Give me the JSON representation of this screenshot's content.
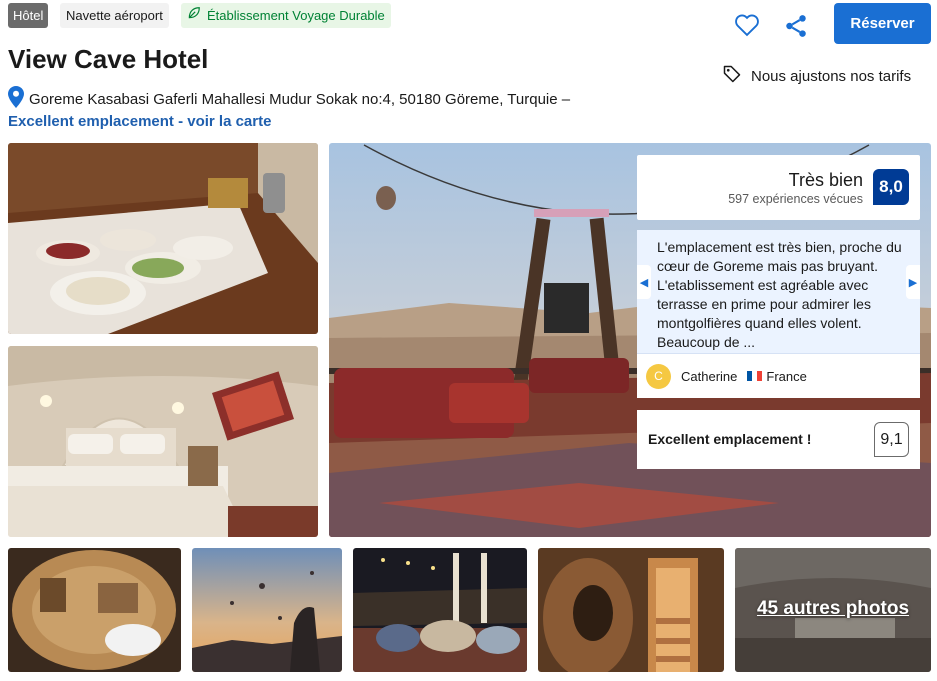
{
  "badges": {
    "type": "Hôtel",
    "shuttle": "Navette aéroport",
    "sustainable": "Établissement Voyage Durable"
  },
  "header": {
    "reserve_label": "Réserver",
    "price_match": "Nous ajustons nos tarifs",
    "title": "View Cave Hotel",
    "address": "Goreme Kasabasi Gaferli Mahallesi Mudur Sokak no:4, 50180 Göreme, Turquie –",
    "location_link": "Excellent emplacement - voir la carte"
  },
  "rating": {
    "word": "Très bien",
    "count": "597 expériences vécues",
    "score": "8,0"
  },
  "review": {
    "text": "L'emplacement est très bien, proche du cœur de Goreme mais pas bruyant. L'etablissement est agréable avec terrasse en prime pour admirer les montgolfières quand elles volent. Beaucoup de ...",
    "avatar_initial": "C",
    "author": "Catherine",
    "country": "France"
  },
  "location_rating": {
    "label": "Excellent emplacement !",
    "score": "9,1"
  },
  "gallery": {
    "more_photos": "45 autres photos"
  },
  "colors": {
    "primary": "#1a6fd3",
    "score_bg": "#003b95",
    "link": "#1f5fae",
    "sustainable_bg": "#e8f6e6",
    "sustainable_text": "#008234",
    "review_bg": "#ebf3ff"
  },
  "icons": {
    "favorite": "heart-icon",
    "share": "share-icon",
    "price_tag": "tag-icon",
    "location": "map-pin-icon",
    "sustainable": "leaf-icon"
  }
}
